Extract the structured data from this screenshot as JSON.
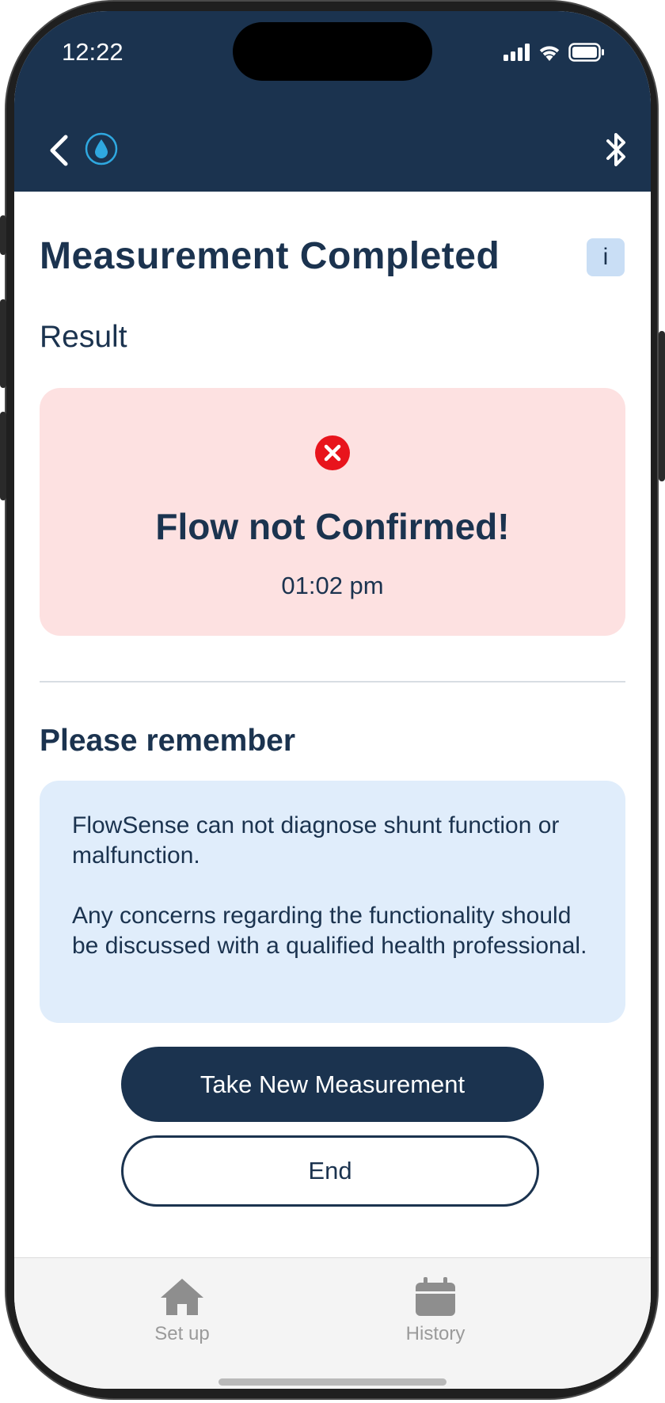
{
  "status_bar": {
    "time": "12:22",
    "icons": [
      "signal-icon",
      "wifi-icon",
      "battery-icon"
    ]
  },
  "header": {
    "back_icon": "chevron-left-icon",
    "app_icon": "water-drop-icon",
    "bluetooth_icon": "bluetooth-icon"
  },
  "page": {
    "title": "Measurement Completed",
    "info_label": "i",
    "section_label": "Result"
  },
  "result": {
    "status_icon": "error-x-icon",
    "title": "Flow not Confirmed!",
    "time": "01:02 pm"
  },
  "remember": {
    "title": "Please remember",
    "paragraph_1": "FlowSense can not diagnose shunt function or malfunction.",
    "paragraph_2": "Any concerns regarding the functionality should be discussed with a qualified health professional."
  },
  "actions": {
    "primary_label": "Take New Measurement",
    "secondary_label": "End"
  },
  "tabbar": {
    "items": [
      {
        "label": "Set up",
        "icon": "home-icon"
      },
      {
        "label": "History",
        "icon": "calendar-icon"
      }
    ]
  },
  "colors": {
    "header_bg": "#1b334f",
    "result_card_bg": "#fde1e1",
    "notice_card_bg": "#e0edfb",
    "error_red": "#e8141c",
    "drop_blue": "#2fa8e0"
  }
}
